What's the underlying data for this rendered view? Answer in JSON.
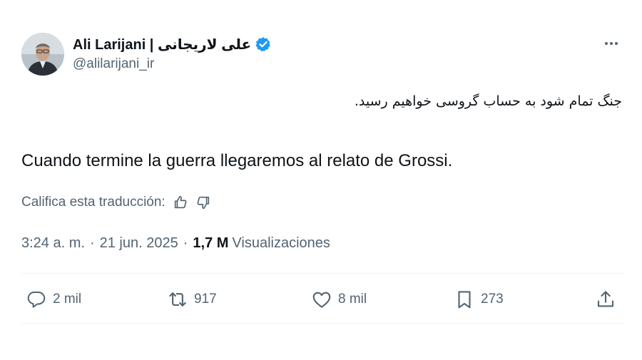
{
  "author": {
    "display_name": "Ali Larijani | علی لاریجانی",
    "handle": "@alilarijani_ir",
    "verified": true
  },
  "tweet": {
    "original_text": "جنگ تمام شود به حساب گروسی خواهیم رسید.",
    "translated_text": "Cuando termine la guerra llegaremos al relato de Grossi.",
    "rate_translation_label": "Califica esta traducción:",
    "time": "3:24 a. m.",
    "separator": "·",
    "date": "21 jun. 2025",
    "views_count": "1,7 M",
    "views_label": "Visualizaciones"
  },
  "actions": {
    "replies": "2 mil",
    "reposts": "917",
    "likes": "8 mil",
    "bookmarks": "273"
  },
  "colors": {
    "text_primary": "#0f1419",
    "text_secondary": "#536471",
    "verified_blue": "#1d9bf0",
    "divider": "#eff3f4"
  },
  "icons": [
    "verified-badge-icon",
    "more-options-icon",
    "thumbs-up-icon",
    "thumbs-down-icon",
    "reply-icon",
    "repost-icon",
    "like-icon",
    "bookmark-icon",
    "share-icon"
  ]
}
